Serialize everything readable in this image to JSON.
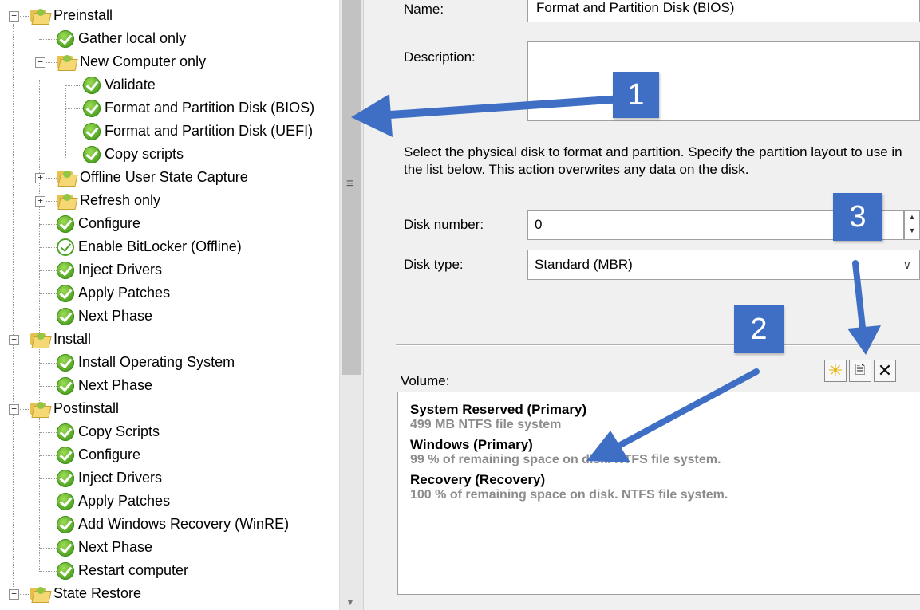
{
  "tree": {
    "items": [
      {
        "label": "Preinstall",
        "kind": "folder",
        "level": 0,
        "expander": "−"
      },
      {
        "label": "Gather local only",
        "kind": "check",
        "level": 1
      },
      {
        "label": "New Computer only",
        "kind": "folder",
        "level": 1,
        "expander": "−"
      },
      {
        "label": "Validate",
        "kind": "check",
        "level": 2
      },
      {
        "label": "Format and Partition Disk (BIOS)",
        "kind": "check",
        "level": 2
      },
      {
        "label": "Format and Partition Disk (UEFI)",
        "kind": "check",
        "level": 2
      },
      {
        "label": "Copy scripts",
        "kind": "check",
        "level": 2
      },
      {
        "label": "Offline User State Capture",
        "kind": "folder",
        "level": 1,
        "expander": "+"
      },
      {
        "label": "Refresh only",
        "kind": "folder",
        "level": 1,
        "expander": "+"
      },
      {
        "label": "Configure",
        "kind": "check",
        "level": 1
      },
      {
        "label": "Enable BitLocker (Offline)",
        "kind": "check-outline",
        "level": 1
      },
      {
        "label": "Inject Drivers",
        "kind": "check",
        "level": 1
      },
      {
        "label": "Apply Patches",
        "kind": "check",
        "level": 1
      },
      {
        "label": "Next Phase",
        "kind": "check",
        "level": 1
      },
      {
        "label": "Install",
        "kind": "folder",
        "level": 0,
        "expander": "−"
      },
      {
        "label": "Install Operating System",
        "kind": "check",
        "level": 1
      },
      {
        "label": "Next Phase",
        "kind": "check",
        "level": 1
      },
      {
        "label": "Postinstall",
        "kind": "folder",
        "level": 0,
        "expander": "−"
      },
      {
        "label": "Copy Scripts",
        "kind": "check",
        "level": 1
      },
      {
        "label": "Configure",
        "kind": "check",
        "level": 1
      },
      {
        "label": "Inject Drivers",
        "kind": "check",
        "level": 1
      },
      {
        "label": "Apply Patches",
        "kind": "check",
        "level": 1
      },
      {
        "label": "Add Windows Recovery (WinRE)",
        "kind": "check",
        "level": 1
      },
      {
        "label": "Next Phase",
        "kind": "check",
        "level": 1
      },
      {
        "label": "Restart computer",
        "kind": "check",
        "level": 1
      },
      {
        "label": "State Restore",
        "kind": "folder",
        "level": 0,
        "expander": "−"
      }
    ]
  },
  "props": {
    "name_label": "Name:",
    "name_value": "Format and Partition Disk (BIOS)",
    "description_label": "Description:",
    "description_value": "",
    "info_text": "Select the physical disk to format and partition.  Specify the partition layout to use in the list below. This action overwrites any data on the disk.",
    "disk_number_label": "Disk number:",
    "disk_number_value": "0",
    "disk_type_label": "Disk type:",
    "disk_type_value": "Standard (MBR)",
    "volume_label": "Volume:",
    "volumes": [
      {
        "name": "System Reserved (Primary)",
        "desc": "499 MB NTFS file system"
      },
      {
        "name": "Windows (Primary)",
        "desc": "99 % of remaining space on disk. NTFS file system."
      },
      {
        "name": "Recovery (Recovery)",
        "desc": "100 % of remaining space on disk. NTFS file system."
      }
    ]
  },
  "icons": {
    "new_volume": "starburst-icon",
    "volume_properties": "properties-icon",
    "delete_volume": "x-icon"
  },
  "callouts": [
    "1",
    "2",
    "3"
  ],
  "colors": {
    "callout": "#3f6fc5",
    "check_green": "#4ea322",
    "folder_yellow": "#f5d873",
    "pane_bg": "#f0f0f0"
  }
}
